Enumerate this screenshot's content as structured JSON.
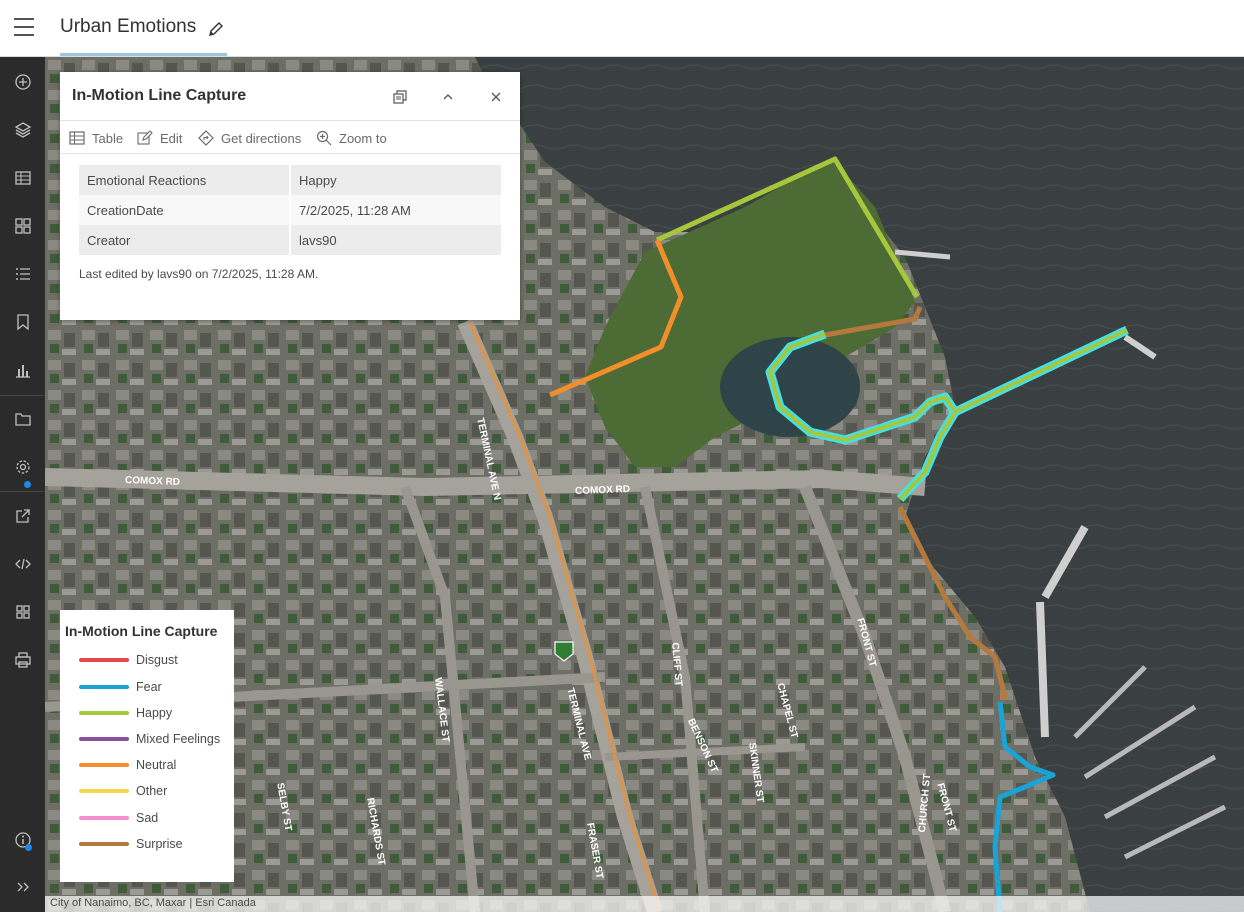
{
  "header": {
    "title": "Urban Emotions"
  },
  "rail": {
    "icons": [
      "add-icon",
      "layers-icon",
      "table-icon",
      "basemap-icon",
      "legend-list-icon",
      "bookmark-icon",
      "chart-icon",
      "map-properties-icon",
      "settings-icon",
      "share-icon",
      "embed-icon",
      "apps-icon",
      "print-icon",
      "info-icon",
      "expand-icon"
    ]
  },
  "popup": {
    "title": "In-Motion Line Capture",
    "toolbar": {
      "table": "Table",
      "edit": "Edit",
      "directions": "Get directions",
      "zoom": "Zoom to"
    },
    "rows": [
      {
        "key": "Emotional Reactions",
        "value": "Happy"
      },
      {
        "key": "CreationDate",
        "value": "7/2/2025, 11:28 AM"
      },
      {
        "key": "Creator",
        "value": "lavs90"
      }
    ],
    "last_edited": "Last edited by lavs90 on 7/2/2025, 11:28 AM."
  },
  "legend": {
    "title": "In-Motion Line Capture",
    "items": [
      {
        "label": "Disgust",
        "color": "#e8474b"
      },
      {
        "label": "Fear",
        "color": "#1aa3d6"
      },
      {
        "label": "Happy",
        "color": "#a6c73c"
      },
      {
        "label": "Mixed Feelings",
        "color": "#8c4f9f"
      },
      {
        "label": "Neutral",
        "color": "#f28f2c"
      },
      {
        "label": "Other",
        "color": "#f8d84a"
      },
      {
        "label": "Sad",
        "color": "#f28fce"
      },
      {
        "label": "Surprise",
        "color": "#b5793d"
      }
    ]
  },
  "map": {
    "street_labels": [
      "COMOX RD",
      "COMOX RD",
      "TERMINAL AVE N",
      "TERMINAL AVE",
      "CLIFF ST",
      "WALLACE ST",
      "BENSON ST",
      "SKINNER ST",
      "CHAPEL ST",
      "FRONT ST",
      "FRONT ST",
      "CHURCH ST",
      "SELBY ST",
      "RICHARDS ST",
      "FRASER ST"
    ]
  },
  "attribution": "City of Nanaimo, BC, Maxar | Esri Canada"
}
